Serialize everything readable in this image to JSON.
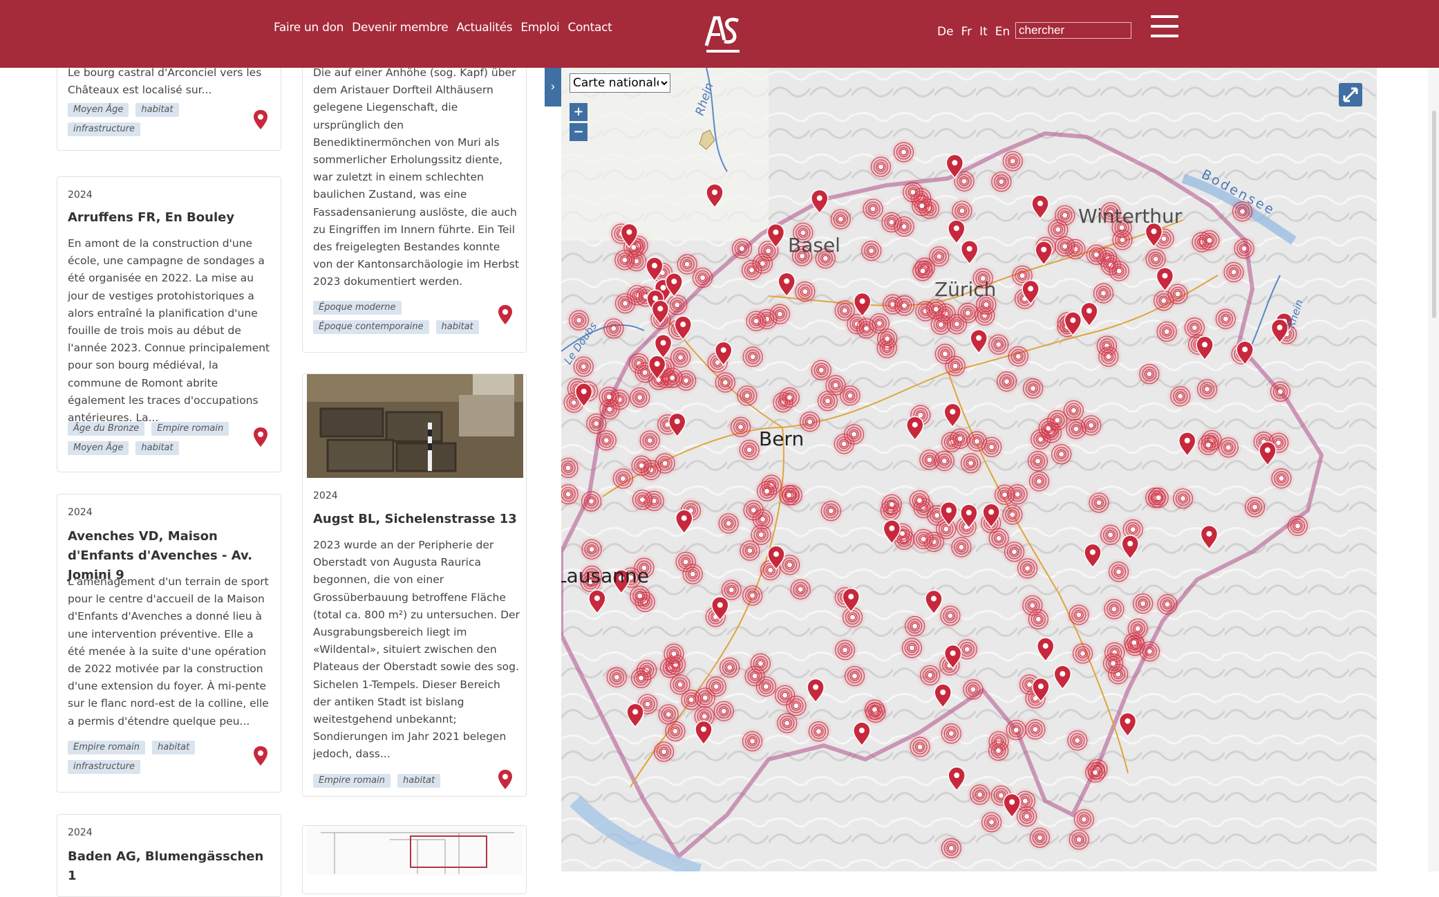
{
  "header": {
    "nav": [
      "Faire un don",
      "Devenir membre",
      "Actualités",
      "Emploi",
      "Contact"
    ],
    "logo_text": "AS",
    "languages": [
      "De",
      "Fr",
      "It",
      "En"
    ],
    "search_placeholder": "chercher",
    "colors": {
      "brand": "#a52a3a",
      "tag_bg": "#d9e4ef",
      "map_ctrl": "#3f6fa3",
      "pin": "#c8283c"
    }
  },
  "left_column": [
    {
      "text": "Le bourg castral d'Arconciel vers les Châteaux est localisé sur...",
      "tags": [
        "Moyen Âge",
        "habitat",
        "infrastructure"
      ]
    },
    {
      "year": "2024",
      "title": "Arruffens FR, En Bouley",
      "text": "En amont de la construction d'une école, une campagne de sondages a été organisée en 2022. La mise au jour de vestiges protohistoriques a alors entraîné la planification d'une fouille de trois mois au début de l'année 2023. Connue principalement pour son bourg médiéval, la commune de Romont abrite également les traces d'occupations antérieures. La...",
      "tags": [
        "Âge du Bronze",
        "Empire romain",
        "Moyen Âge",
        "habitat"
      ]
    },
    {
      "year": "2024",
      "title": "Avenches VD, Maison d'Enfants d'Avenches - Av. Jomini 9",
      "text": "L'aménagement d'un terrain de sport pour le centre d'accueil de la Maison d'Enfants d'Avenches a donné lieu à une intervention préventive. Elle a été menée à la suite d'une opération de 2022 motivée par la construction d'une extension du foyer. À mi-pente sur le flanc nord-est de la colline, elle a permis d'étendre quelque peu...",
      "tags": [
        "Empire romain",
        "habitat",
        "infrastructure"
      ]
    },
    {
      "year": "2024",
      "title": "Baden AG, Blumengässchen 1"
    }
  ],
  "middle_column": [
    {
      "text": "Die auf einer Anhöhe (sog. Kapf) über dem Aristauer Dorfteil Althäusern gelegene Liegenschaft, die ursprünglich den Benediktinermönchen von Muri als sommerlicher Erholungssitz diente, war zuletzt in einem schlechten baulichen Zustand, was eine Fassadensanierung auslöste, die auch zu Eingriffen im Innern führte. Ein Teil des freigelegten Bestandes konnte von der Kantonsarchäologie im Herbst 2023 dokumentiert werden.",
      "tags": [
        "Époque moderne",
        "Époque contemporaine",
        "habitat"
      ]
    },
    {
      "year": "2024",
      "title": "Augst BL, Sichelenstrasse 13",
      "text": "2023 wurde an der Peripherie der Oberstadt von Augusta Raurica begonnen, die von einer Grossüberbauung betroffene Fläche (total ca. 800 m²) zu untersuchen. Der Ausgrabungsbereich liegt im «Wildental», situiert zwischen den Plateaus der Oberstadt sowie des sog. Sichelen 1-Tempels. Dieser Bereich der antiken Stadt ist bislang weitestgehend unbekannt; Sondierungen im Jahr 2021 belegen jedoch, dass...",
      "tags": [
        "Empire romain",
        "habitat"
      ]
    }
  ],
  "map": {
    "basemap_selected": "Carte nationale",
    "zoom_in": "+",
    "zoom_out": "−",
    "toggle_icon": "›",
    "labels": [
      "Rhein",
      "Basel",
      "Zürich",
      "Winterthur",
      "Bodensee",
      "Le Doubs",
      "Bern",
      "Lausanne",
      "Rhein"
    ]
  }
}
